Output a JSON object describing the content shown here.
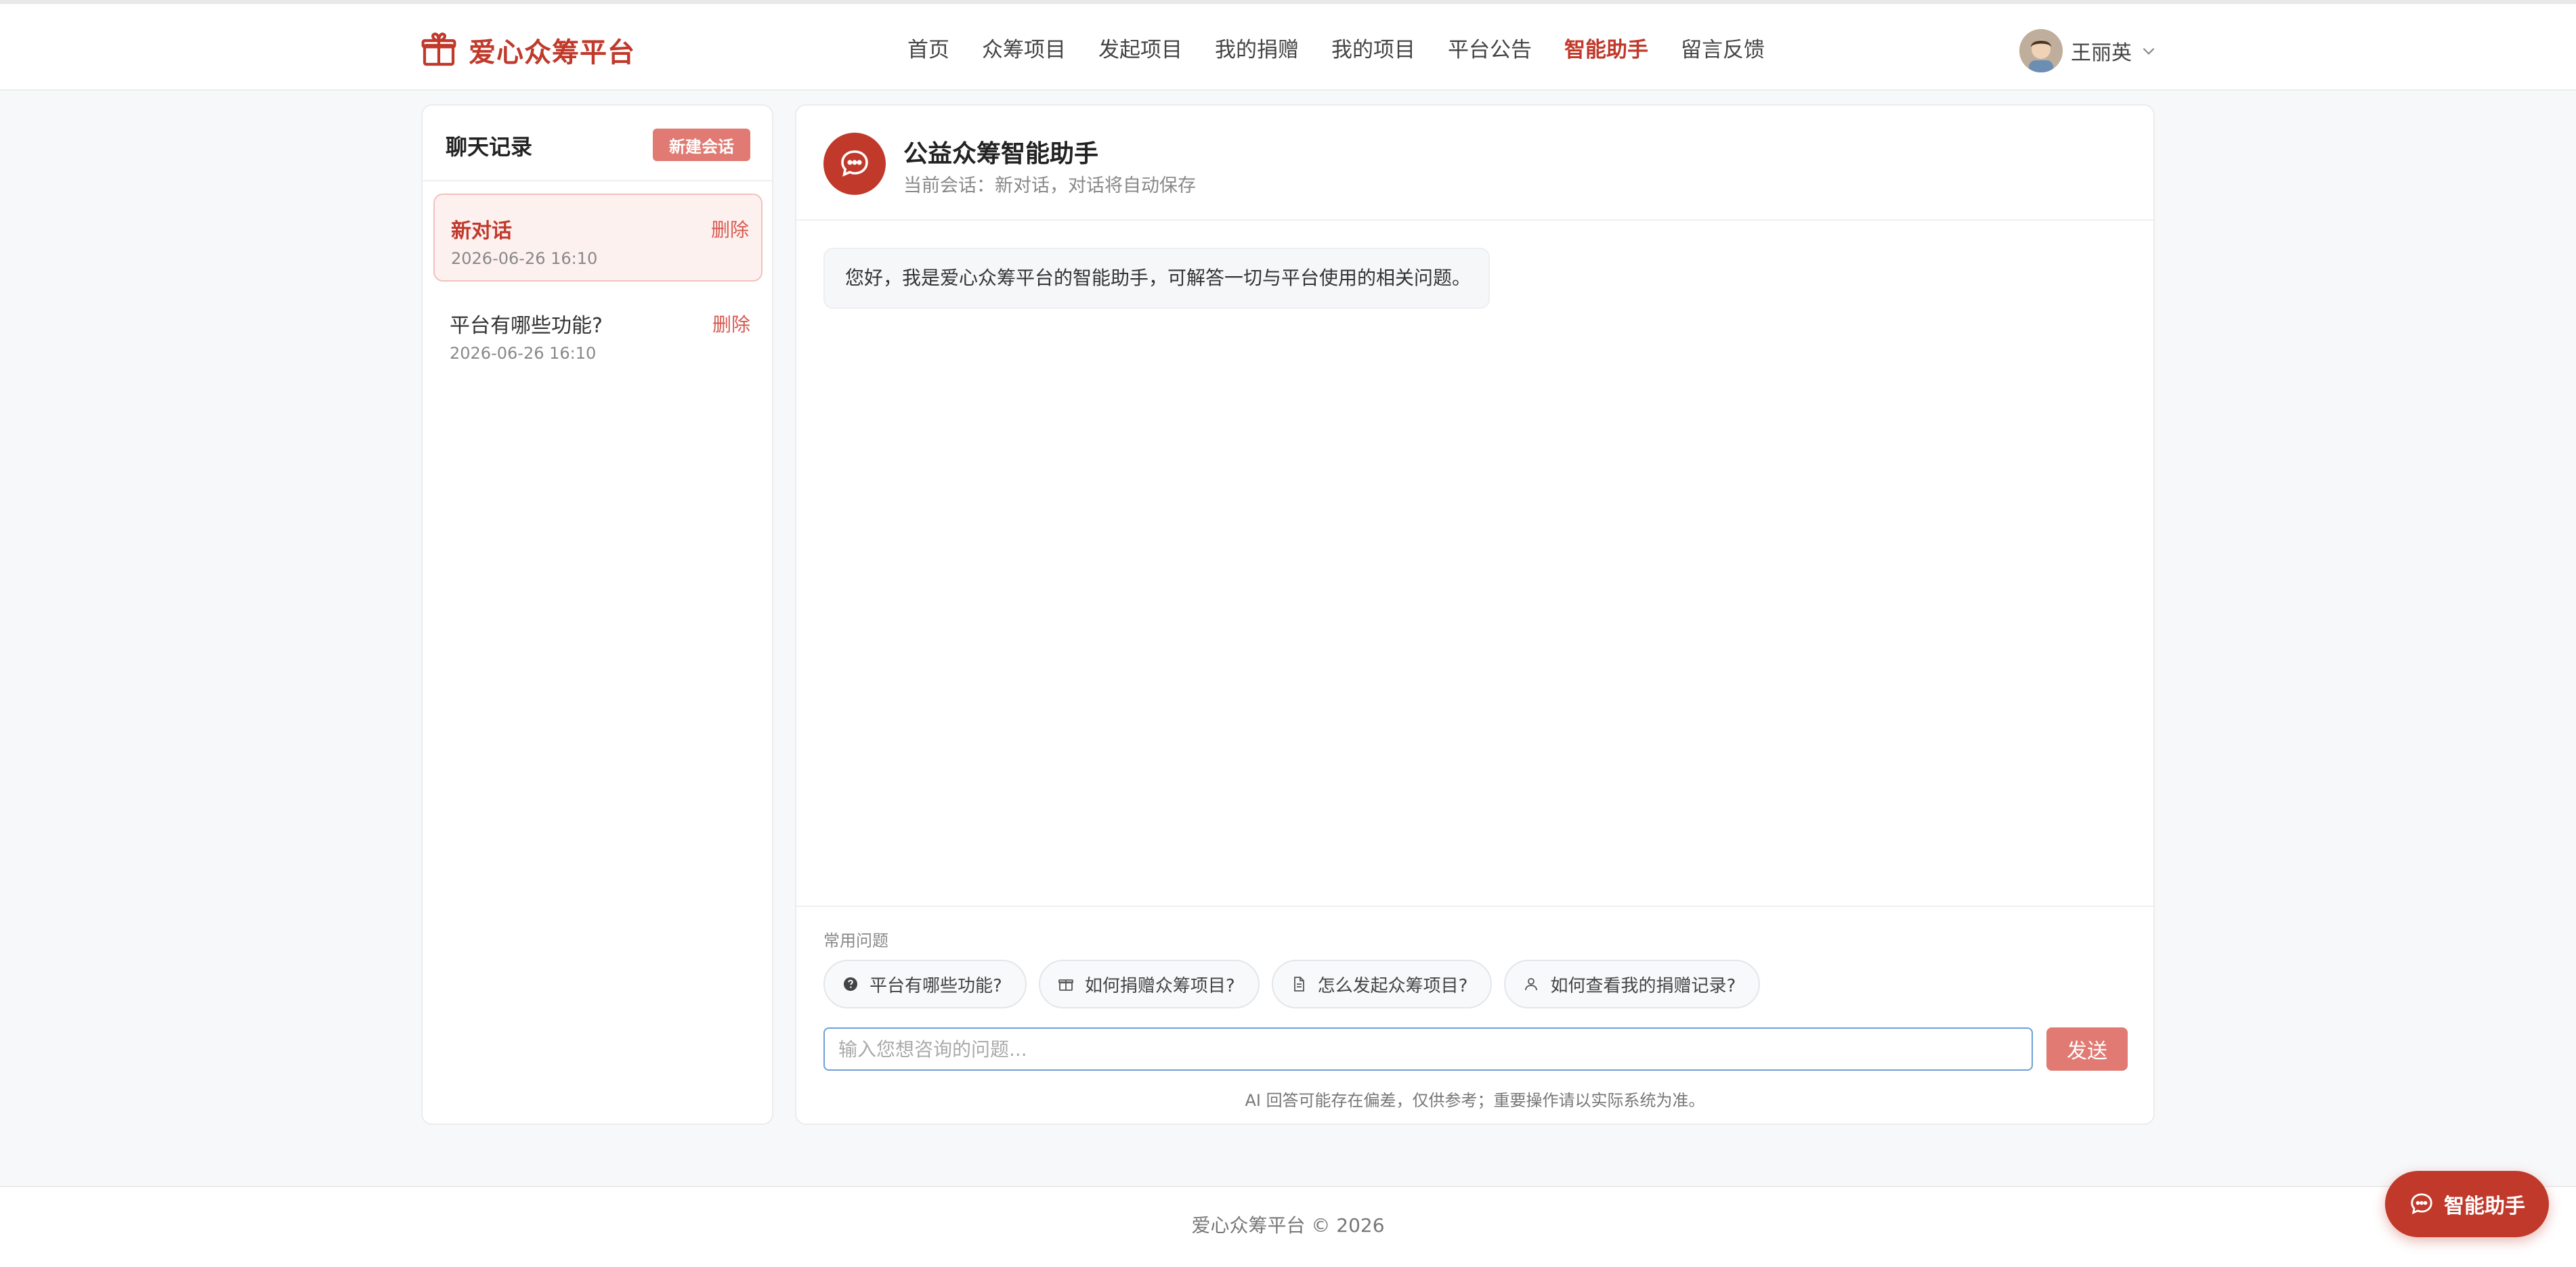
{
  "brand": {
    "name": "爱心众筹平台",
    "icon": "gift-icon"
  },
  "nav": {
    "items": [
      {
        "label": "首页"
      },
      {
        "label": "众筹项目"
      },
      {
        "label": "发起项目"
      },
      {
        "label": "我的捐赠"
      },
      {
        "label": "我的项目"
      },
      {
        "label": "平台公告"
      },
      {
        "label": "智能助手",
        "active": true
      },
      {
        "label": "留言反馈"
      }
    ]
  },
  "user": {
    "name": "王丽英",
    "icon": "chevron-down-icon"
  },
  "sidebar": {
    "title": "聊天记录",
    "new_button": "新建会话",
    "conversations": [
      {
        "title": "新对话",
        "date": "2026-06-26 16:10",
        "delete": "删除",
        "active": true
      },
      {
        "title": "平台有哪些功能?",
        "date": "2026-06-26 16:10",
        "delete": "删除",
        "active": false
      }
    ]
  },
  "chat": {
    "title": "公益众筹智能助手",
    "subtitle": "当前会话：新对话，对话将自动保存",
    "messages": [
      {
        "role": "assistant",
        "text": "您好，我是爱心众筹平台的智能助手，可解答一切与平台使用的相关问题。"
      }
    ],
    "faq_label": "常用问题",
    "faq": [
      {
        "label": "平台有哪些功能?",
        "icon": "question-circle-icon"
      },
      {
        "label": "如何捐赠众筹项目?",
        "icon": "gift-icon"
      },
      {
        "label": "怎么发起众筹项目?",
        "icon": "document-icon"
      },
      {
        "label": "如何查看我的捐赠记录?",
        "icon": "user-icon"
      }
    ],
    "input": {
      "placeholder": "输入您想咨询的问题...",
      "value": ""
    },
    "send_label": "发送",
    "disclaimer": "AI 回答可能存在偏差，仅供参考；重要操作请以实际系统为准。"
  },
  "footer": {
    "text": "爱心众筹平台 © 2026"
  },
  "fab": {
    "label": "智能助手",
    "icon": "chat-bubble-icon"
  },
  "colors": {
    "accent": "#c0392b",
    "accent_light": "#e07a73",
    "input_border": "#6f9fd8"
  }
}
